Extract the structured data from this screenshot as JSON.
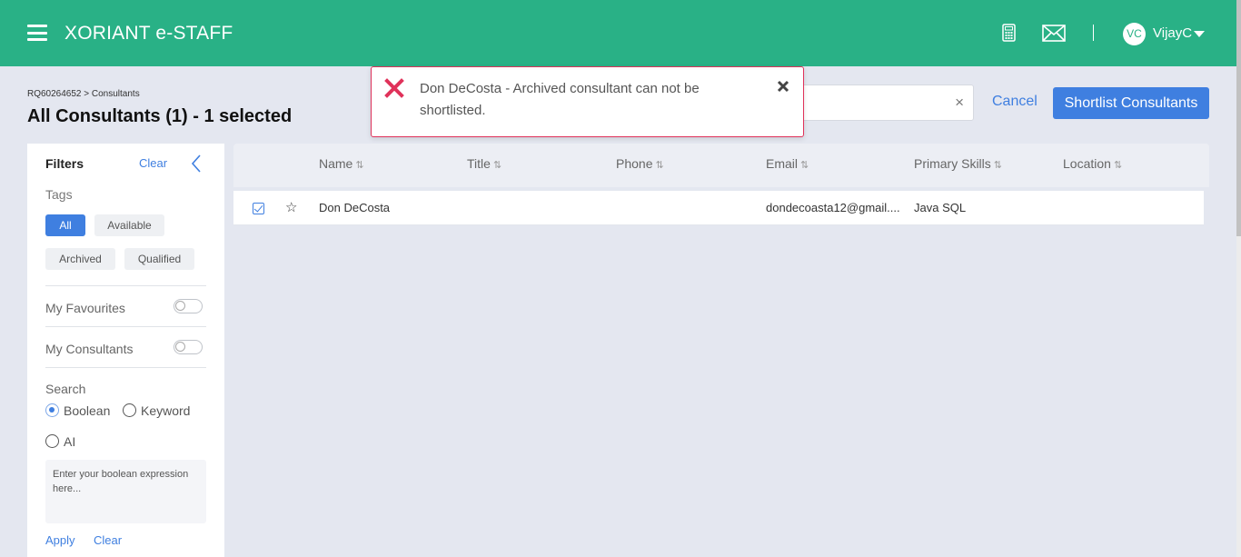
{
  "header": {
    "app_title": "XORIANT e-STAFF",
    "user_initials": "VC",
    "username": "VijayC",
    "icons": [
      "menu-icon",
      "calculator-icon",
      "mail-icon",
      "caret-down-icon"
    ]
  },
  "page": {
    "breadcrumb": "RQ60264652 > Consultants",
    "title": "All Consultants (1) - 1 selected"
  },
  "actions": {
    "search_value": "",
    "cancel_label": "Cancel",
    "shortlist_label": "Shortlist Consultants"
  },
  "toast": {
    "message": "Don DeCosta - Archived consultant can not be shortlisted.",
    "accent": "#e0325a"
  },
  "filters": {
    "title": "Filters",
    "clear_label": "Clear",
    "tags_label": "Tags",
    "tags": [
      "All",
      "Available",
      "Archived",
      "Qualified"
    ],
    "active_tag": "All",
    "my_favourites_label": "My Favourites",
    "my_consultants_label": "My Consultants",
    "search_label": "Search",
    "search_modes": [
      "Boolean",
      "Keyword",
      "AI"
    ],
    "selected_mode": "Boolean",
    "boolean_placeholder": "Enter your boolean expression here...",
    "apply_label": "Apply",
    "clear2_label": "Clear"
  },
  "table": {
    "columns": [
      "Name",
      "Title",
      "Phone",
      "Email",
      "Primary Skills",
      "Location"
    ],
    "sort_glyph": "⇅",
    "rows": [
      {
        "name": "Don DeCosta",
        "title": "",
        "phone": "",
        "email": "dondecoasta12@gmail....",
        "skills": "Java SQL",
        "location": "",
        "selected": true
      }
    ]
  },
  "colors": {
    "header": "#29b186",
    "primary": "#3f7fe0",
    "background": "#e4e7f0"
  }
}
